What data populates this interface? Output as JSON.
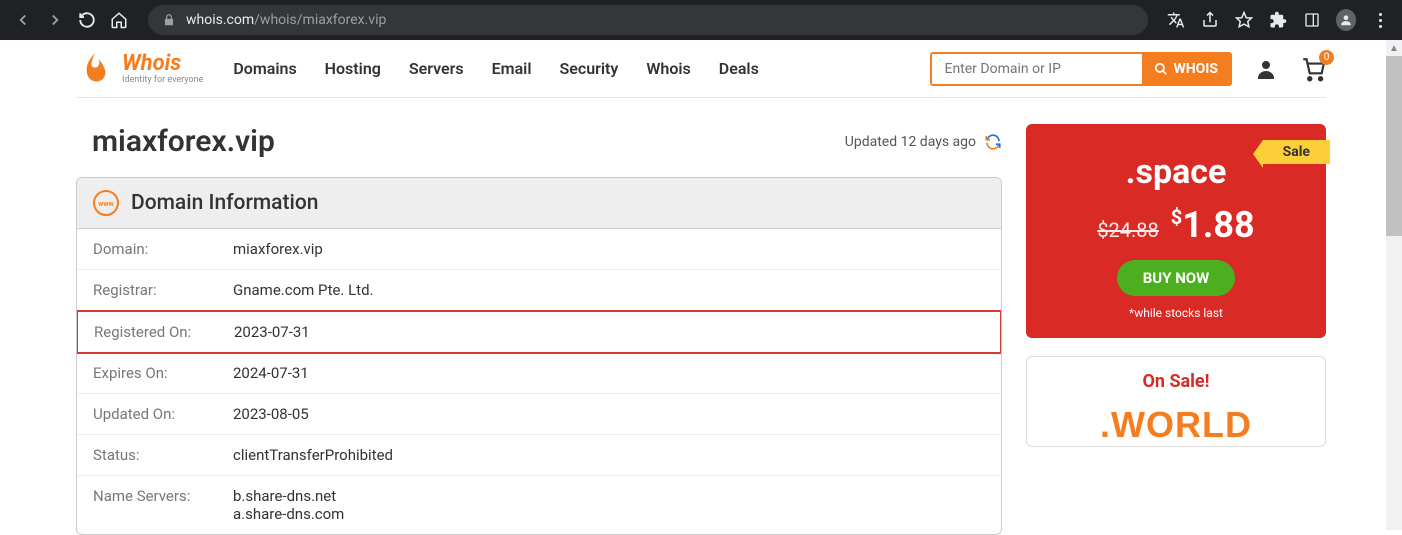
{
  "browser": {
    "url_host": "whois.com",
    "url_path": "/whois/miaxforex.vip"
  },
  "logo": {
    "main": "Whois",
    "sub": "Identity for everyone"
  },
  "nav": {
    "domains": "Domains",
    "hosting": "Hosting",
    "servers": "Servers",
    "email": "Email",
    "security": "Security",
    "whois": "Whois",
    "deals": "Deals"
  },
  "search": {
    "placeholder": "Enter Domain or IP",
    "button": "WHOIS"
  },
  "cart": {
    "count": "0"
  },
  "page": {
    "title": "miaxforex.vip",
    "updated": "Updated 12 days ago"
  },
  "panel": {
    "heading": "Domain Information",
    "rows": {
      "domain_label": "Domain:",
      "domain_val": "miaxforex.vip",
      "registrar_label": "Registrar:",
      "registrar_val": "Gname.com Pte. Ltd.",
      "registered_label": "Registered On:",
      "registered_val": "2023-07-31",
      "expires_label": "Expires On:",
      "expires_val": "2024-07-31",
      "updated_label": "Updated On:",
      "updated_val": "2023-08-05",
      "status_label": "Status:",
      "status_val": "clientTransferProhibited",
      "ns_label": "Name Servers:",
      "ns_val1": "b.share-dns.net",
      "ns_val2": "a.share-dns.com"
    }
  },
  "promo": {
    "sale": "Sale",
    "tld": ".space",
    "old_price": "$24.88",
    "new_price_currency": "$",
    "new_price": "1.88",
    "buy": "BUY NOW",
    "note": "*while stocks last"
  },
  "onsale": {
    "title": "On Sale!",
    "tld": ".WORLD"
  }
}
